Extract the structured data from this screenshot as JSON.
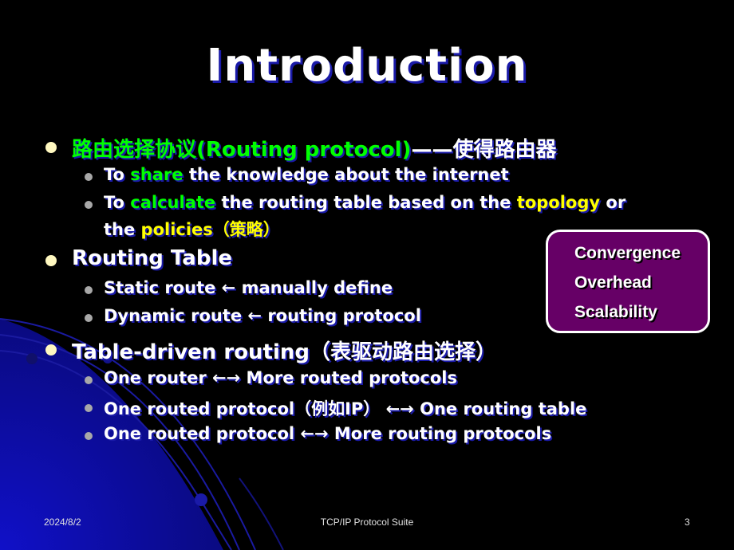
{
  "slide": {
    "title": "Introduction",
    "bullets": [
      {
        "segments": [
          {
            "text": "路由选择协议(Routing protocol)",
            "color": "green"
          },
          {
            "text": "——使得路由器",
            "color": "white"
          }
        ],
        "sub": [
          {
            "segments": [
              {
                "text": "To ",
                "color": "white"
              },
              {
                "text": "share",
                "color": "green"
              },
              {
                "text": " the knowledge about the internet",
                "color": "white"
              }
            ]
          },
          {
            "segments": [
              {
                "text": "To ",
                "color": "white"
              },
              {
                "text": "calculate",
                "color": "green"
              },
              {
                "text": " the routing table based on the ",
                "color": "white"
              },
              {
                "text": "topology",
                "color": "yellow"
              },
              {
                "text": " or",
                "color": "white"
              }
            ],
            "continuation": [
              {
                "text": "the ",
                "color": "white"
              },
              {
                "text": "policies（策略）",
                "color": "yellow"
              }
            ]
          }
        ]
      },
      {
        "segments": [
          {
            "text": "Routing Table",
            "color": "white"
          }
        ],
        "sub": [
          {
            "segments": [
              {
                "text": "Static route ← manually define",
                "color": "white"
              }
            ]
          },
          {
            "segments": [
              {
                "text": "Dynamic route ← routing protocol",
                "color": "white"
              }
            ]
          }
        ]
      },
      {
        "segments": [
          {
            "text": "Table-driven routing（表驱动路由选择）",
            "color": "white"
          }
        ],
        "sub": [
          {
            "segments": [
              {
                "text": "One router ←→ More routed protocols",
                "color": "white"
              }
            ]
          },
          {
            "segments": [
              {
                "text": "One routed protocol（例如IP） ←→ One routing table",
                "color": "white"
              }
            ]
          },
          {
            "segments": [
              {
                "text": "One routed protocol ←→ More routing protocols",
                "color": "white"
              }
            ]
          }
        ]
      }
    ],
    "callout_box": {
      "items": [
        "Convergence",
        "Overhead",
        "Scalability"
      ],
      "background": "#660066",
      "border": "#ffffff"
    }
  },
  "footer": {
    "date": "2024/8/2",
    "center": "TCP/IP Protocol Suite",
    "page_number": "3"
  },
  "colors": {
    "background": "#000000",
    "green": "#00ff00",
    "yellow": "#ffff00",
    "text": "#ffffff",
    "text_shadow": "#1a1aa8"
  }
}
